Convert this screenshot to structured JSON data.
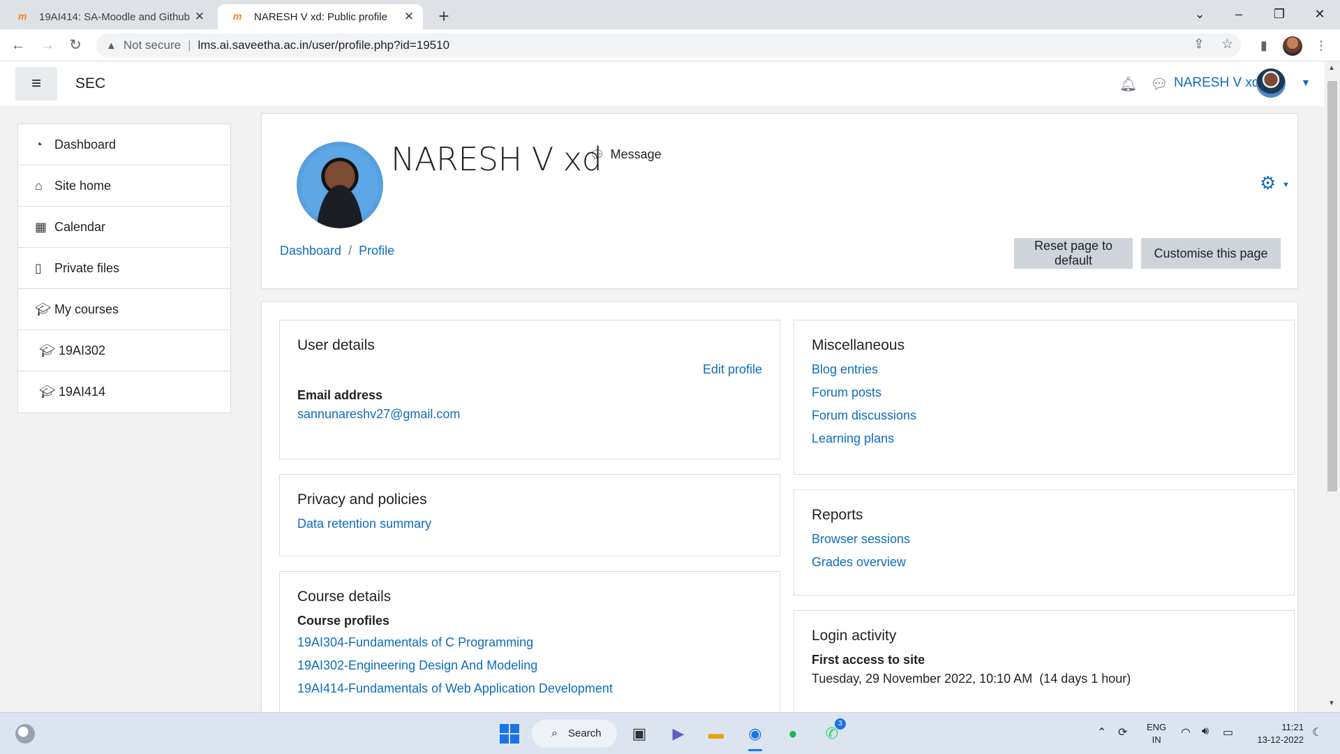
{
  "browser": {
    "tabs": [
      {
        "title": "19AI414: SA-Moodle and Github",
        "favicon": "m"
      },
      {
        "title": "NARESH V xd: Public profile",
        "favicon": "m"
      }
    ],
    "new_tab": "+",
    "address": {
      "security": "Not secure",
      "url": "lms.ai.saveetha.ac.in/user/profile.php?id=19510"
    }
  },
  "navbar": {
    "site_name": "SEC",
    "user_name": "NARESH V xd"
  },
  "drawer": {
    "items": [
      {
        "label": "Dashboard",
        "icon": "dashboard-icon"
      },
      {
        "label": "Site home",
        "icon": "home-icon"
      },
      {
        "label": "Calendar",
        "icon": "calendar-icon"
      },
      {
        "label": "Private files",
        "icon": "file-icon"
      },
      {
        "label": "My courses",
        "icon": "graduation-cap-icon"
      },
      {
        "label": "19AI302",
        "icon": "graduation-cap-icon"
      },
      {
        "label": "19AI414",
        "icon": "graduation-cap-icon"
      }
    ]
  },
  "profile": {
    "full_name": "NARESH V xd",
    "message_label": "Message",
    "breadcrumb": [
      "Dashboard",
      "Profile"
    ],
    "buttons": {
      "reset": "Reset page to default",
      "customise": "Customise this page"
    }
  },
  "user_details": {
    "title": "User details",
    "edit_profile": "Edit profile",
    "email_label": "Email address",
    "email": "sannunareshv27@gmail.com"
  },
  "privacy": {
    "title": "Privacy and policies",
    "link": "Data retention summary"
  },
  "course_details": {
    "title": "Course details",
    "subtitle": "Course profiles",
    "courses": [
      "19AI304-Fundamentals of C Programming",
      "19AI302-Engineering Design And Modeling",
      "19AI414-Fundamentals of Web Application Development"
    ]
  },
  "misc": {
    "title": "Miscellaneous",
    "links": [
      "Blog entries",
      "Forum posts",
      "Forum discussions",
      "Learning plans"
    ]
  },
  "reports": {
    "title": "Reports",
    "links": [
      "Browser sessions",
      "Grades overview"
    ]
  },
  "login_activity": {
    "title": "Login activity",
    "first_access_label": "First access to site",
    "first_access_value": "Tuesday, 29 November 2022, 10:10 AM  (14 days 1 hour)"
  },
  "taskbar": {
    "search_label": "Search",
    "whatsapp_badge": "3",
    "lang_line1": "ENG",
    "lang_line2": "IN",
    "time": "11:21",
    "date": "13-12-2022"
  },
  "colors": {
    "link": "#0f6cbf",
    "button_bg": "#ced4da",
    "page_bg": "#f2f2f2"
  }
}
